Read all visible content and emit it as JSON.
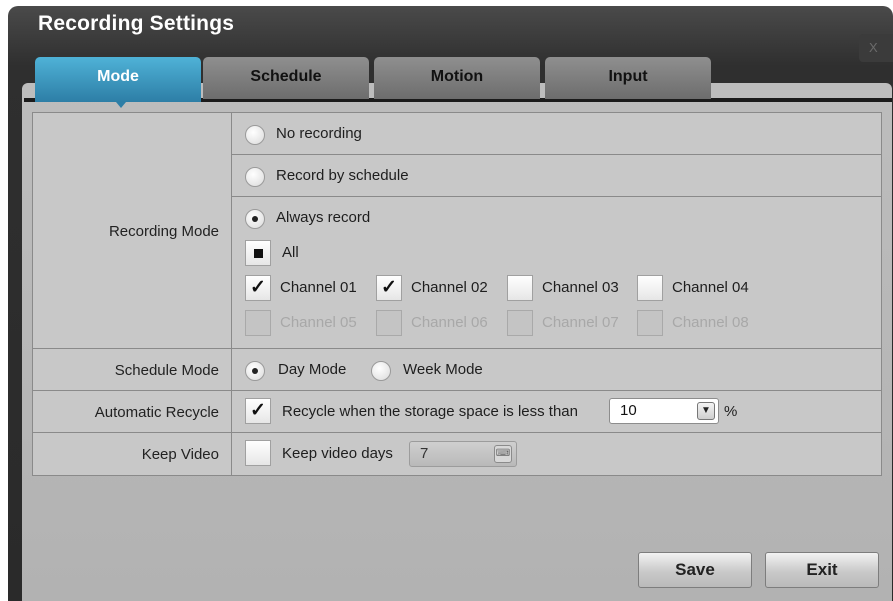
{
  "window": {
    "title": "Recording Settings"
  },
  "tabs": [
    {
      "label": "Mode",
      "active": true
    },
    {
      "label": "Schedule",
      "active": false
    },
    {
      "label": "Motion",
      "active": false
    },
    {
      "label": "Input",
      "active": false
    }
  ],
  "recording_mode": {
    "label": "Recording Mode",
    "options": [
      {
        "label": "No recording",
        "selected": false
      },
      {
        "label": "Record by schedule",
        "selected": false
      },
      {
        "label": "Always record",
        "selected": true
      }
    ],
    "all_label": "All",
    "channels": [
      {
        "label": "Channel 01",
        "checked": true,
        "enabled": true
      },
      {
        "label": "Channel 02",
        "checked": true,
        "enabled": true
      },
      {
        "label": "Channel 03",
        "checked": false,
        "enabled": true
      },
      {
        "label": "Channel 04",
        "checked": false,
        "enabled": true
      },
      {
        "label": "Channel 05",
        "checked": false,
        "enabled": false
      },
      {
        "label": "Channel 06",
        "checked": false,
        "enabled": false
      },
      {
        "label": "Channel 07",
        "checked": false,
        "enabled": false
      },
      {
        "label": "Channel 08",
        "checked": false,
        "enabled": false
      }
    ]
  },
  "schedule_mode": {
    "label": "Schedule Mode",
    "options": [
      {
        "label": "Day Mode",
        "selected": true
      },
      {
        "label": "Week Mode",
        "selected": false
      }
    ]
  },
  "automatic_recycle": {
    "label": "Automatic Recycle",
    "checkbox_label": "Recycle when the storage space is less than",
    "checked": true,
    "value": "10",
    "unit": "%"
  },
  "keep_video": {
    "label": "Keep Video",
    "checkbox_label": "Keep video days",
    "checked": false,
    "value": "7"
  },
  "buttons": {
    "save": "Save",
    "exit": "Exit"
  },
  "colors": {
    "active_tab": "#2d7ea6",
    "panel": "#bdbdbd",
    "window": "#2f2f2f"
  }
}
